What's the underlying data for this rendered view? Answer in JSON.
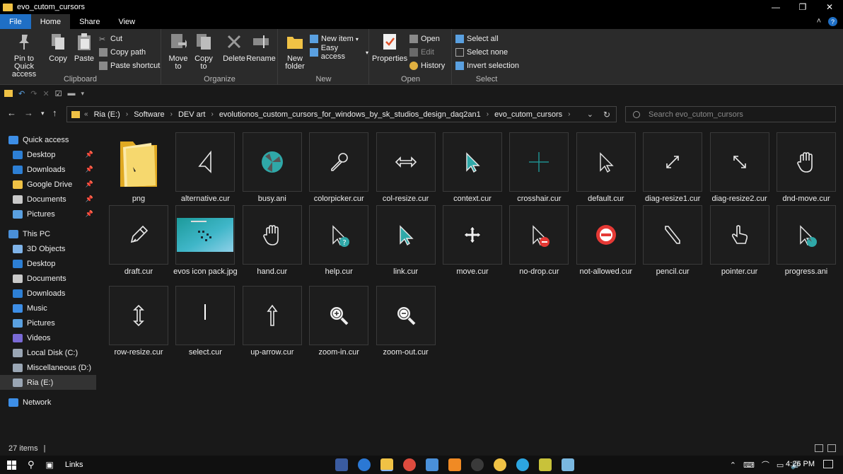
{
  "window": {
    "title": "evo_cutom_cursors"
  },
  "tabs": [
    {
      "label": "File"
    },
    {
      "label": "Home"
    },
    {
      "label": "Share"
    },
    {
      "label": "View"
    }
  ],
  "ribbon": {
    "clipboard": {
      "pin_label": "Pin to Quick access",
      "copy_label": "Copy",
      "paste_label": "Paste",
      "cut_label": "Cut",
      "copy_path_label": "Copy path",
      "paste_shortcut_label": "Paste shortcut",
      "group_label": "Clipboard"
    },
    "organize": {
      "move_to_label": "Move to",
      "copy_to_label": "Copy to",
      "delete_label": "Delete",
      "rename_label": "Rename",
      "group_label": "Organize"
    },
    "new": {
      "new_folder_label": "New folder",
      "new_item_label": "New item",
      "easy_access_label": "Easy access",
      "group_label": "New"
    },
    "open": {
      "properties_label": "Properties",
      "open_label": "Open",
      "edit_label": "Edit",
      "history_label": "History",
      "group_label": "Open"
    },
    "select": {
      "select_all_label": "Select all",
      "select_none_label": "Select none",
      "invert_label": "Invert selection",
      "group_label": "Select"
    }
  },
  "address": {
    "overflow": "«",
    "crumbs": [
      "Ria (E:)",
      "Software",
      "DEV art",
      "evolutionos_custom_cursors_for_windows_by_sk_studios_design_daq2an1",
      "evo_cutom_cursors"
    ]
  },
  "search": {
    "placeholder": "Search evo_cutom_cursors"
  },
  "navpane": {
    "items": [
      {
        "label": "Quick access",
        "color": "#3d8ee6"
      },
      {
        "label": "Desktop",
        "color": "#2d7fd4"
      },
      {
        "label": "Downloads",
        "color": "#2d7fd4"
      },
      {
        "label": "Google Drive",
        "color": "#f0c245"
      },
      {
        "label": "Documents",
        "color": "#c9c9c9"
      },
      {
        "label": "Pictures",
        "color": "#5aa0e0"
      },
      {
        "label": "This PC",
        "color": "#4a90d9"
      },
      {
        "label": "3D Objects",
        "color": "#7fb3e8"
      },
      {
        "label": "Desktop",
        "color": "#2d7fd4"
      },
      {
        "label": "Documents",
        "color": "#c9c9c9"
      },
      {
        "label": "Downloads",
        "color": "#2d7fd4"
      },
      {
        "label": "Music",
        "color": "#3d8ee6"
      },
      {
        "label": "Pictures",
        "color": "#5aa0e0"
      },
      {
        "label": "Videos",
        "color": "#7a6ad6"
      },
      {
        "label": "Local Disk (C:)",
        "color": "#9aa6b4"
      },
      {
        "label": "Miscellaneous (D:)",
        "color": "#9aa6b4"
      },
      {
        "label": "Ria (E:)",
        "color": "#9aa6b4"
      },
      {
        "label": "Network",
        "color": "#3d8ee6"
      }
    ]
  },
  "files": [
    {
      "name": "png",
      "kind": "folder-icon"
    },
    {
      "name": "alternative.cur",
      "kind": "alternative-cursor-icon"
    },
    {
      "name": "busy.ani",
      "kind": "busy-cursor-icon"
    },
    {
      "name": "colorpicker.cur",
      "kind": "colorpicker-cursor-icon"
    },
    {
      "name": "col-resize.cur",
      "kind": "col-resize-cursor-icon"
    },
    {
      "name": "context.cur",
      "kind": "context-cursor-icon"
    },
    {
      "name": "crosshair.cur",
      "kind": "crosshair-cursor-icon"
    },
    {
      "name": "default.cur",
      "kind": "default-cursor-icon"
    },
    {
      "name": "diag-resize1.cur",
      "kind": "diag-resize1-cursor-icon"
    },
    {
      "name": "diag-resize2.cur",
      "kind": "diag-resize2-cursor-icon"
    },
    {
      "name": "dnd-move.cur",
      "kind": "dnd-move-cursor-icon"
    },
    {
      "name": "draft.cur",
      "kind": "draft-cursor-icon"
    },
    {
      "name": "evos icon pack.jpg",
      "kind": "image-thumbnail"
    },
    {
      "name": "hand.cur",
      "kind": "hand-cursor-icon"
    },
    {
      "name": "help.cur",
      "kind": "help-cursor-icon"
    },
    {
      "name": "link.cur",
      "kind": "link-cursor-icon"
    },
    {
      "name": "move.cur",
      "kind": "move-cursor-icon"
    },
    {
      "name": "no-drop.cur",
      "kind": "no-drop-cursor-icon"
    },
    {
      "name": "not-allowed.cur",
      "kind": "not-allowed-cursor-icon"
    },
    {
      "name": "pencil.cur",
      "kind": "pencil-cursor-icon"
    },
    {
      "name": "pointer.cur",
      "kind": "pointer-cursor-icon"
    },
    {
      "name": "progress.ani",
      "kind": "progress-cursor-icon"
    },
    {
      "name": "row-resize.cur",
      "kind": "row-resize-cursor-icon"
    },
    {
      "name": "select.cur",
      "kind": "select-cursor-icon"
    },
    {
      "name": "up-arrow.cur",
      "kind": "up-arrow-cursor-icon"
    },
    {
      "name": "zoom-in.cur",
      "kind": "zoom-in-cursor-icon"
    },
    {
      "name": "zoom-out.cur",
      "kind": "zoom-out-cursor-icon"
    }
  ],
  "status": {
    "item_count": "27 items"
  },
  "taskbar": {
    "links_label": "Links",
    "time": "4:26 PM"
  },
  "colors": {
    "accent": "#1f6fc5",
    "teal": "#2fa8a8",
    "folder": "#f0c245",
    "red": "#e53935"
  }
}
